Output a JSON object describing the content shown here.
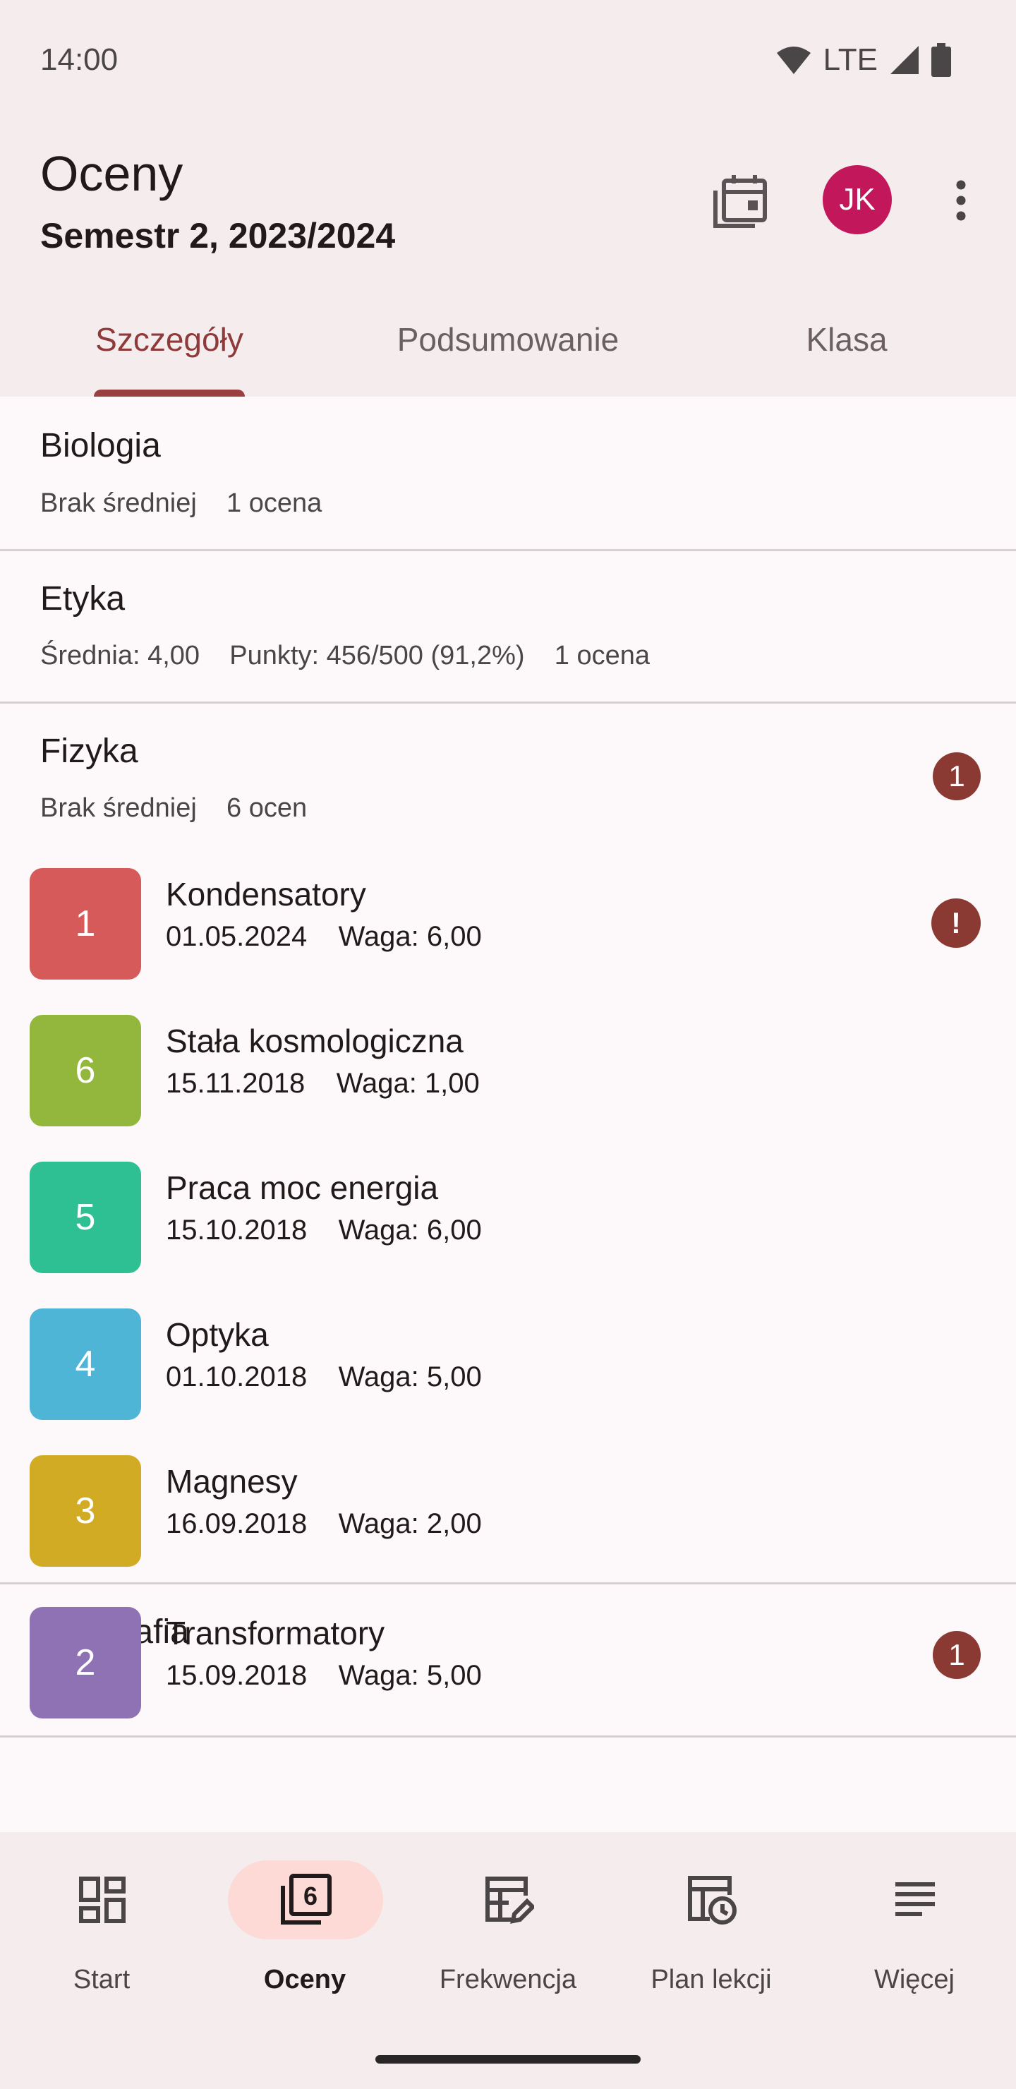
{
  "status_bar": {
    "time": "14:00",
    "network": "LTE"
  },
  "header": {
    "title": "Oceny",
    "subtitle": "Semestr 2, 2023/2024",
    "avatar_initials": "JK",
    "avatar_color": "#c2185b"
  },
  "tabs": [
    {
      "label": "Szczegóły",
      "active": true
    },
    {
      "label": "Podsumowanie",
      "active": false
    },
    {
      "label": "Klasa",
      "active": false
    }
  ],
  "subjects": [
    {
      "name": "Biologia",
      "meta": "Brak średniej    1 ocena"
    },
    {
      "name": "Etyka",
      "meta": "Średnia: 4,00    Punkty: 456/500 (91,2%)    1 ocena"
    },
    {
      "name": "Fizyka",
      "meta": "Brak średniej    6 ocen",
      "badge": "1"
    },
    {
      "name": "Geografia",
      "badge": "1"
    }
  ],
  "grades": [
    {
      "value": "1",
      "name": "Kondensatory",
      "date": "01.05.2024",
      "weight": "Waga: 6,00",
      "color": "#d65a5a",
      "alert": "!"
    },
    {
      "value": "6",
      "name": "Stała kosmologiczna",
      "date": "15.11.2018",
      "weight": "Waga: 1,00",
      "color": "#92b73c"
    },
    {
      "value": "5",
      "name": "Praca moc energia",
      "date": "15.10.2018",
      "weight": "Waga: 6,00",
      "color": "#2ebf93"
    },
    {
      "value": "4",
      "name": "Optyka",
      "date": "01.10.2018",
      "weight": "Waga: 5,00",
      "color": "#4fb5d6"
    },
    {
      "value": "3",
      "name": "Magnesy",
      "date": "16.09.2018",
      "weight": "Waga: 2,00",
      "color": "#d2ab25"
    },
    {
      "value": "2",
      "name": "Transformatory",
      "date": "15.09.2018",
      "weight": "Waga: 5,00",
      "color": "#8e72b3"
    }
  ],
  "bottom_nav": [
    {
      "label": "Start",
      "icon": "dashboard-icon"
    },
    {
      "label": "Oceny",
      "icon": "grades-icon",
      "active": true
    },
    {
      "label": "Frekwencja",
      "icon": "attendance-icon"
    },
    {
      "label": "Plan lekcji",
      "icon": "timetable-icon"
    },
    {
      "label": "Więcej",
      "icon": "menu-icon"
    }
  ]
}
